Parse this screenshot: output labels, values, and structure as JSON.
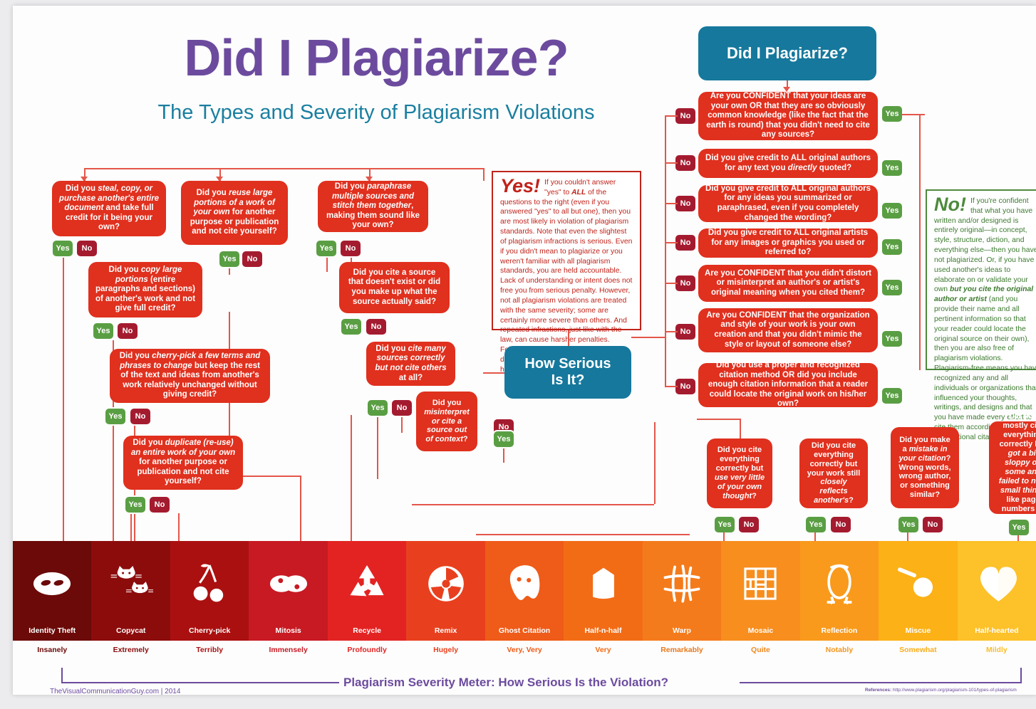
{
  "header": {
    "title": "Did I Plagiarize?",
    "subtitle": "The Types and Severity of Plagiarism Violations"
  },
  "labels": {
    "yes": "Yes",
    "no": "No"
  },
  "banners": {
    "did_i_plagiarize": "Did I Plagiarize?",
    "how_serious": "How Serious\nIs It?",
    "how_serious_line1": "How Serious",
    "how_serious_line2": "Is It?"
  },
  "left_questions": [
    {
      "id": "steal-copy-purchase",
      "text_html": "Did you <i>steal, copy, or purchase another's entire document</i> and take full credit for it being your own?"
    },
    {
      "id": "reuse-large-portions",
      "text_html": "Did you <i>reuse large portions of a work of your own</i> for another purpose or publication and not cite yourself?"
    },
    {
      "id": "paraphrase-multiple-sources",
      "text_html": "Did you <i>paraphrase multiple sources and stitch them together</i>, making them sound like your own?"
    },
    {
      "id": "copy-large-portions",
      "text_html": "Did you <i>copy large portions</i> (entire paragraphs and sections) of another's work and not give full credit?"
    },
    {
      "id": "cite-nonexistent-source",
      "text_html": "Did you cite a source that doesn't exist or did you make up what the source actually said?"
    },
    {
      "id": "cherry-pick-terms",
      "text_html": "Did you <i>cherry-pick a few terms and phrases to change</i> but keep the rest of the text and ideas from another's work relatively unchanged without giving credit?"
    },
    {
      "id": "cite-many-not-others",
      "text_html": "Did you <i>cite many sources correctly but not cite others</i> at all?"
    },
    {
      "id": "duplicate-reuse-own-work",
      "text_html": "Did you <i>duplicate (re-use) an entire work of your own</i> for another purpose or publication and not cite yourself?"
    },
    {
      "id": "misinterpret-out-of-context",
      "text_html": "Did you <i>misinterpret or cite a source out of context</i>?"
    }
  ],
  "right_questions": [
    {
      "id": "confident-own-ideas",
      "text_html": "Are you CONFIDENT that your ideas are your own OR that they are so obviously common knowledge (like the fact that the earth is round) that you didn't need to cite any sources?"
    },
    {
      "id": "credit-direct-quotes",
      "text_html": "Did you give credit to ALL original authors for any text you <i>directly</i> quoted?"
    },
    {
      "id": "credit-summarized-ideas",
      "text_html": "Did you give credit to ALL original authors for any ideas you summarized or paraphrased, even if you completely changed the wording?"
    },
    {
      "id": "credit-artists-images",
      "text_html": "Did you give credit to ALL original artists for any images or graphics you used or referred to?"
    },
    {
      "id": "confident-no-distortion",
      "text_html": "Are you CONFIDENT that you didn't distort or misinterpret an author's or artist's original meaning when you cited them?"
    },
    {
      "id": "confident-own-organization",
      "text_html": "Are you CONFIDENT that the organization and style of your work is your own creation and that you didn't mimic the style or layout of someone else?"
    },
    {
      "id": "proper-citation-method",
      "text_html": "Did you use a proper and recognized citation method OR did you include enough citation information that a reader could locate the original work on his/her own?"
    }
  ],
  "bottom_questions": [
    {
      "id": "cite-correctly-little-own-thought",
      "text_html": "Did you cite everything correctly but <i>use very little of your own thought</i>?"
    },
    {
      "id": "cite-correctly-reflects-another",
      "text_html": "Did you cite everything correctly but your work still <i>closely reflects another's</i>?"
    },
    {
      "id": "mistake-in-citation",
      "text_html": "Did you make a <i>mistake in your citation</i>? Wrong words, wrong author, or something similar?"
    },
    {
      "id": "mostly-cite-sloppy",
      "text_html": "Did you mostly cite everything correctly but <i>got a bit sloppy on some and failed to note small things</i> like page numbers or publishers?"
    }
  ],
  "panels": {
    "yes": {
      "lead": "Yes!",
      "body_html": "If you couldn't answer \"yes\" to <i>ALL</i> of the questions to the right (even if you answered \"yes\" to all but one), then you are most likely in violation of plagiarism standards. Note that even the slightest of plagiarism infractions is serious. Even if you didn't mean to plagiarize or you weren't familiar with all plagiarism standards, you are held accountable. Lack of understanding or intent does not free you from serious penalty. However, not all plagiarism violations are treated with the same severity; some are certainly more severe than others. And repeated infractions, just like with the law, can cause harsher penalties. Follow the chart to the left and below to determine how you plargiarized and how serious it is."
    },
    "no": {
      "lead": "No!",
      "body_html": "If you're confident that what you have written and/or designed is entirely original&mdash;in concept, style, structure, diction, and everything else&mdash;then you have not plagiarized. Or, if you have used another's ideas to elaborate on or validate your own <i>but you cite the original author or artist</i> (and you provide their name and all pertinent information so that your reader could locate the original source on their own), then you are also free of plagiarism violations. Plagiarism-free means you have recognized any and all individuals or organizations that influenced your thoughts, writings, and designs and that you have made every effort to cite them according to conventional citation practices."
    }
  },
  "severity_meter": {
    "title": "Plagiarism Severity Meter: How Serious Is the Violation?",
    "segments": [
      {
        "name": "Identity Theft",
        "adverb": "Insanely",
        "icon": "mask-icon",
        "color": "#6b0a08",
        "adverb_color": "#6b0a08"
      },
      {
        "name": "Copycat",
        "adverb": "Extremely",
        "icon": "cats-icon",
        "color": "#8c0c0c",
        "adverb_color": "#8c0c0c"
      },
      {
        "name": "Cherry-pick",
        "adverb": "Terribly",
        "icon": "cherries-icon",
        "color": "#ab1010",
        "adverb_color": "#ab1010"
      },
      {
        "name": "Mitosis",
        "adverb": "Immensely",
        "icon": "mitosis-icon",
        "color": "#c71a23",
        "adverb_color": "#c71a23"
      },
      {
        "name": "Recycle",
        "adverb": "Profoundly",
        "icon": "recycle-icon",
        "color": "#e32322",
        "adverb_color": "#e32322"
      },
      {
        "name": "Remix",
        "adverb": "Hugely",
        "icon": "record-icon",
        "color": "#e8401e",
        "adverb_color": "#e8401e"
      },
      {
        "name": "Ghost Citation",
        "adverb": "Very, Very",
        "icon": "ghost-icon",
        "color": "#ef5b18",
        "adverb_color": "#ef5b18"
      },
      {
        "name": "Half-n-half",
        "adverb": "Very",
        "icon": "carton-icon",
        "color": "#f26c16",
        "adverb_color": "#f26c16"
      },
      {
        "name": "Warp",
        "adverb": "Remarkably",
        "icon": "warp-grid-icon",
        "color": "#f47b1b",
        "adverb_color": "#e8791c"
      },
      {
        "name": "Mosaic",
        "adverb": "Quite",
        "icon": "mosaic-icon",
        "color": "#f78e1e",
        "adverb_color": "#f0891f"
      },
      {
        "name": "Reflection",
        "adverb": "Notably",
        "icon": "mirror-icon",
        "color": "#f99a1c",
        "adverb_color": "#f4951f"
      },
      {
        "name": "Miscue",
        "adverb": "Somewhat",
        "icon": "miscue-icon",
        "color": "#fcb116",
        "adverb_color": "#f9ad1d"
      },
      {
        "name": "Half-hearted",
        "adverb": "Mildly",
        "icon": "halfheart-icon",
        "color": "#fdc129",
        "adverb_color": "#fcbe2a"
      }
    ]
  },
  "footer": {
    "credit": "TheVisualCommunicationGuy.com | 2014",
    "references_label": "References:",
    "references_url": "http://www.plagiarism.org/plagiarism-101/types-of-plagiarism"
  }
}
